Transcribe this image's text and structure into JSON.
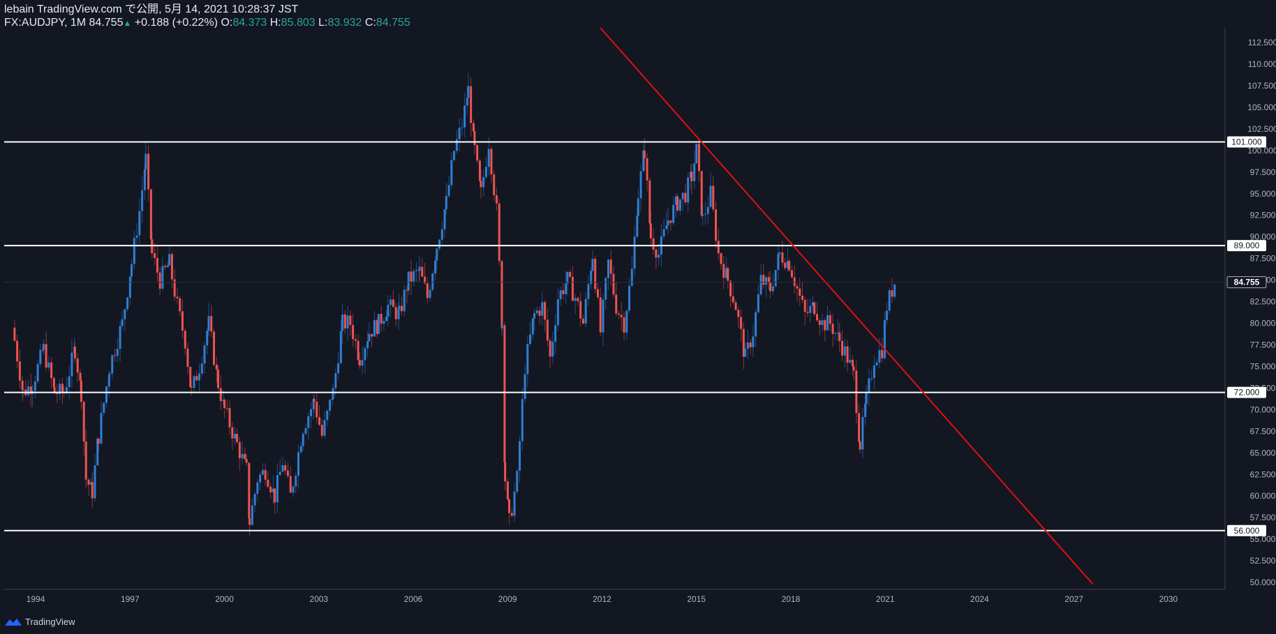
{
  "header": {
    "publish_line": "lebain TradingView.com で公開, 5月 14, 2021 10:28:37 JST",
    "symbol": "FX:AUDJPY, 1M",
    "last": "84.755",
    "change": "+0.188 (+0.22%)",
    "o_label": "O:",
    "o_value": "84.373",
    "h_label": "H:",
    "h_value": "85.803",
    "l_label": "L:",
    "l_value": "83.932",
    "c_label": "C:",
    "c_value": "84.755"
  },
  "footer": {
    "brand": "TradingView",
    "logo_icon": "tradingview-logo-icon"
  },
  "colors": {
    "background": "#131722",
    "up": "#2f7fd4",
    "down": "#ef5350",
    "hline": "#ffffff",
    "trendline": "#e01010",
    "axis_text": "#b2b5be",
    "teal": "#26a69a"
  },
  "chart_data": {
    "type": "candlestick",
    "title": "FX:AUDJPY, 1M",
    "timeframe": "1M",
    "x_range": [
      1993.0,
      2031.8
    ],
    "y_range": [
      49.2,
      114.2
    ],
    "y_ticks": [
      "50.000",
      "52.500",
      "55.000",
      "57.500",
      "60.000",
      "62.500",
      "65.000",
      "67.500",
      "70.000",
      "72.500",
      "75.000",
      "77.500",
      "80.000",
      "82.500",
      "85.000",
      "87.500",
      "90.000",
      "92.500",
      "95.000",
      "97.500",
      "100.000",
      "102.500",
      "105.000",
      "107.500",
      "110.000",
      "112.500"
    ],
    "x_ticks": [
      "1994",
      "1997",
      "2000",
      "2003",
      "2006",
      "2009",
      "2012",
      "2015",
      "2018",
      "2021",
      "2024",
      "2027",
      "2030"
    ],
    "last_price_label": "84.755",
    "horizontal_levels": [
      {
        "value": 101.0,
        "label": "101.000"
      },
      {
        "value": 89.0,
        "label": "89.000"
      },
      {
        "value": 72.0,
        "label": "72.000"
      },
      {
        "value": 56.0,
        "label": "56.000"
      }
    ],
    "trendline": {
      "x1": 2011.95,
      "y1": 114.2,
      "x2": 2027.6,
      "y2": 49.8
    },
    "closes": [
      [
        1993.33,
        78
      ],
      [
        1993.6,
        72
      ],
      [
        1993.9,
        73
      ],
      [
        1994.25,
        77
      ],
      [
        1994.6,
        72
      ],
      [
        1994.9,
        72
      ],
      [
        1995.25,
        77
      ],
      [
        1995.45,
        72
      ],
      [
        1995.6,
        62
      ],
      [
        1995.8,
        60.5
      ],
      [
        1996.0,
        67
      ],
      [
        1996.35,
        75
      ],
      [
        1996.75,
        80
      ],
      [
        1997.05,
        87
      ],
      [
        1997.3,
        93
      ],
      [
        1997.5,
        99
      ],
      [
        1997.7,
        88
      ],
      [
        1997.95,
        85
      ],
      [
        1998.25,
        87
      ],
      [
        1998.5,
        82
      ],
      [
        1998.75,
        78
      ],
      [
        1998.95,
        72
      ],
      [
        1999.2,
        75
      ],
      [
        1999.5,
        80
      ],
      [
        1999.8,
        73
      ],
      [
        2000.0,
        70
      ],
      [
        2000.4,
        66
      ],
      [
        2000.7,
        63
      ],
      [
        2000.8,
        57
      ],
      [
        2001.05,
        62
      ],
      [
        2001.3,
        63
      ],
      [
        2001.6,
        60
      ],
      [
        2001.85,
        64
      ],
      [
        2002.1,
        60
      ],
      [
        2002.5,
        68
      ],
      [
        2002.85,
        71
      ],
      [
        2003.1,
        67
      ],
      [
        2003.45,
        72
      ],
      [
        2003.75,
        80
      ],
      [
        2004.0,
        80
      ],
      [
        2004.3,
        76
      ],
      [
        2004.6,
        79
      ],
      [
        2004.9,
        80
      ],
      [
        2005.2,
        82
      ],
      [
        2005.55,
        81
      ],
      [
        2005.85,
        85
      ],
      [
        2006.2,
        86
      ],
      [
        2006.45,
        83
      ],
      [
        2006.75,
        89
      ],
      [
        2007.05,
        94
      ],
      [
        2007.3,
        100
      ],
      [
        2007.55,
        103
      ],
      [
        2007.75,
        107
      ],
      [
        2007.95,
        100
      ],
      [
        2008.15,
        95
      ],
      [
        2008.4,
        101
      ],
      [
        2008.65,
        93
      ],
      [
        2008.82,
        80
      ],
      [
        2008.92,
        62
      ],
      [
        2009.05,
        57
      ],
      [
        2009.3,
        62
      ],
      [
        2009.55,
        75
      ],
      [
        2009.85,
        81
      ],
      [
        2010.1,
        82
      ],
      [
        2010.35,
        76
      ],
      [
        2010.6,
        83
      ],
      [
        2010.9,
        85
      ],
      [
        2011.15,
        83
      ],
      [
        2011.4,
        80
      ],
      [
        2011.7,
        88
      ],
      [
        2011.95,
        79
      ],
      [
        2012.2,
        87
      ],
      [
        2012.45,
        82
      ],
      [
        2012.7,
        80
      ],
      [
        2012.95,
        86
      ],
      [
        2013.15,
        95
      ],
      [
        2013.35,
        100
      ],
      [
        2013.55,
        90
      ],
      [
        2013.8,
        88
      ],
      [
        2014.1,
        92
      ],
      [
        2014.4,
        94
      ],
      [
        2014.65,
        95
      ],
      [
        2014.85,
        97
      ],
      [
        2015.0,
        100
      ],
      [
        2015.2,
        92
      ],
      [
        2015.45,
        95
      ],
      [
        2015.7,
        88
      ],
      [
        2016.0,
        85
      ],
      [
        2016.25,
        82
      ],
      [
        2016.55,
        76
      ],
      [
        2016.8,
        79
      ],
      [
        2017.05,
        85
      ],
      [
        2017.35,
        84
      ],
      [
        2017.65,
        88
      ],
      [
        2017.95,
        87
      ],
      [
        2018.2,
        84
      ],
      [
        2018.45,
        81
      ],
      [
        2018.75,
        82
      ],
      [
        2019.0,
        80
      ],
      [
        2019.25,
        80
      ],
      [
        2019.55,
        78
      ],
      [
        2019.8,
        76
      ],
      [
        2020.0,
        74
      ],
      [
        2020.2,
        66
      ],
      [
        2020.4,
        71
      ],
      [
        2020.65,
        76
      ],
      [
        2020.9,
        77
      ],
      [
        2021.05,
        82
      ],
      [
        2021.3,
        84.755
      ]
    ]
  }
}
